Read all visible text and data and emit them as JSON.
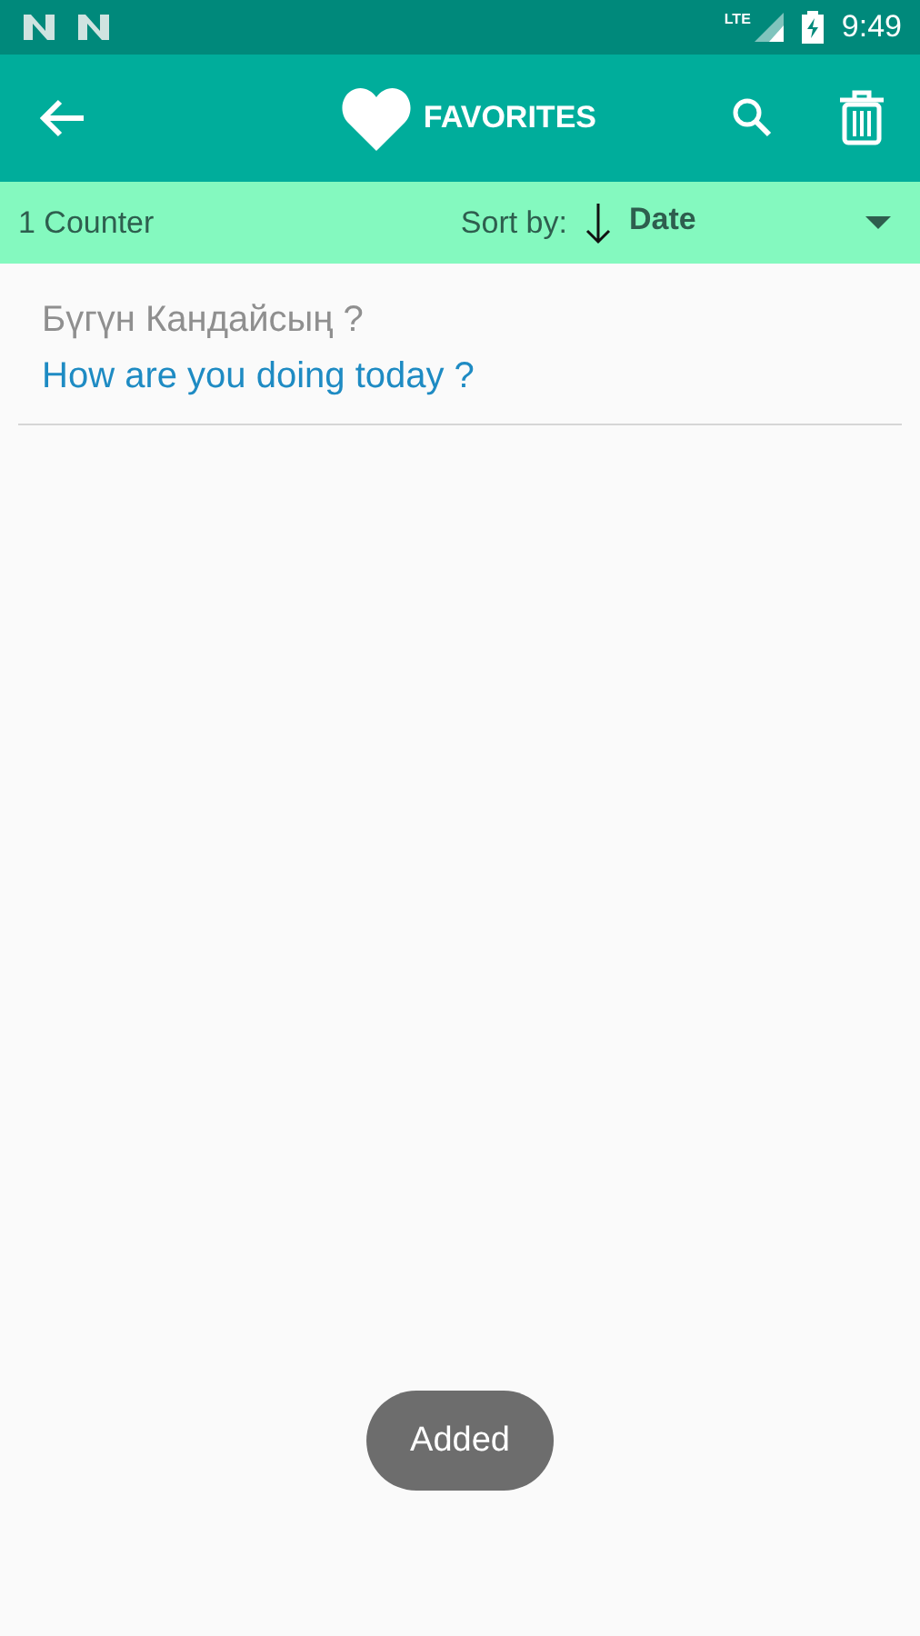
{
  "status_bar": {
    "time": "9:49",
    "network": "LTE"
  },
  "toolbar": {
    "title": "FAVORITES"
  },
  "sort_bar": {
    "count": "1 Counter",
    "sort_label": "Sort by:",
    "sort_value": "Date"
  },
  "items": [
    {
      "source": "Бүгүн Кандайсың ?",
      "translation": "How are you doing today ?"
    }
  ],
  "toast": "Added"
}
